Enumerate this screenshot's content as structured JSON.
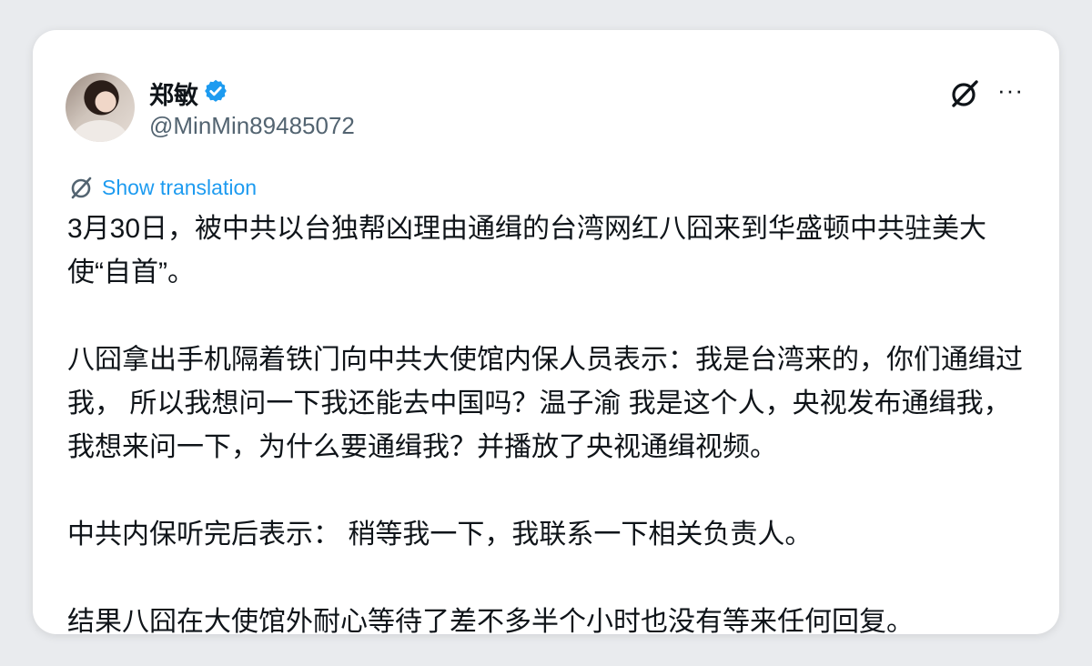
{
  "author": {
    "display_name": "郑敏",
    "handle": "@MinMin89485072",
    "verified": true
  },
  "icons": {
    "verified": "verified-badge-icon",
    "grok": "grok-slash-circle-icon",
    "more": "more-options-icon",
    "translate": "translate-icon"
  },
  "translation_link": "Show translation",
  "more_label": "···",
  "paragraphs": [
    "3月30日，被中共以台独帮凶理由通缉的台湾网红八囧来到华盛顿中共驻美大使“自首”。",
    "八囧拿出手机隔着铁门向中共大使馆内保人员表示：我是台湾来的，你们通缉过我， 所以我想问一下我还能去中国吗？温子渝 我是这个人，央视发布通缉我， 我想来问一下，为什么要通缉我？并播放了央视通缉视频。",
    "中共内保听完后表示： 稍等我一下，我联系一下相关负责人。",
    "结果八囧在大使馆外耐心等待了差不多半个小时也没有等来任何回复。"
  ],
  "colors": {
    "link": "#1d9bf0",
    "text": "#0f1419",
    "muted": "#536471",
    "verified_badge": "#1d9bf0"
  }
}
